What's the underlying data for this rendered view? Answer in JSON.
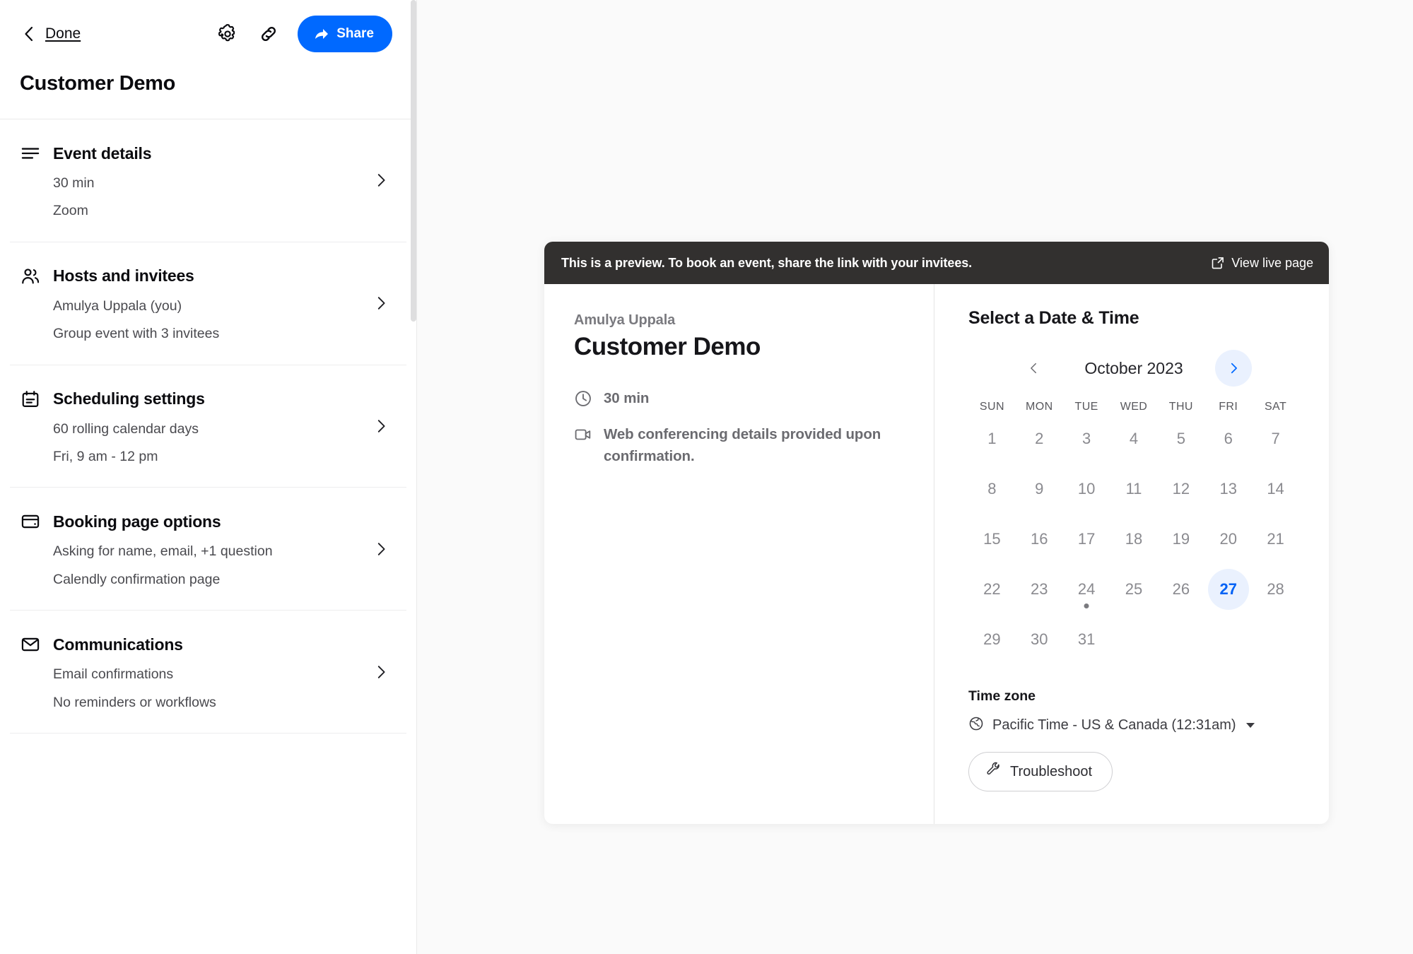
{
  "sidebar": {
    "back_label": "back-chevron",
    "done_label": "Done",
    "gear_icon": "gear-icon",
    "link_icon": "link-icon",
    "share_label": "Share",
    "event_title": "Customer Demo",
    "sections": [
      {
        "icon": "lines-icon",
        "title": "Event details",
        "lines": [
          "30 min",
          "Zoom"
        ]
      },
      {
        "icon": "people-icon",
        "title": "Hosts and invitees",
        "lines": [
          "Amulya Uppala (you)",
          "Group event with 3 invitees"
        ]
      },
      {
        "icon": "calendar-icon",
        "title": "Scheduling settings",
        "lines": [
          "60 rolling calendar days",
          "Fri, 9 am - 12 pm"
        ]
      },
      {
        "icon": "card-icon",
        "title": "Booking page options",
        "lines": [
          "Asking for name, email, +1 question",
          "Calendly confirmation page"
        ]
      },
      {
        "icon": "envelope-icon",
        "title": "Communications",
        "lines": [
          "Email confirmations",
          "No reminders or workflows"
        ]
      }
    ]
  },
  "preview": {
    "banner_text": "This is a preview. To book an event, share the link with your invitees.",
    "view_live_label": "View live page",
    "event": {
      "host": "Amulya Uppala",
      "name": "Customer Demo",
      "duration": "30 min",
      "location": "Web conferencing details provided upon confirmation."
    },
    "calendar": {
      "title": "Select a Date & Time",
      "month": "October 2023",
      "weekdays": [
        "SUN",
        "MON",
        "TUE",
        "WED",
        "THU",
        "FRI",
        "SAT"
      ],
      "leading_blanks": 0,
      "days": [
        1,
        2,
        3,
        4,
        5,
        6,
        7,
        8,
        9,
        10,
        11,
        12,
        13,
        14,
        15,
        16,
        17,
        18,
        19,
        20,
        21,
        22,
        23,
        24,
        25,
        26,
        27,
        28,
        29,
        30,
        31
      ],
      "selected_day": 27,
      "dotted_days": [
        24
      ],
      "prev_label": "prev-month",
      "next_label": "next-month"
    },
    "timezone": {
      "title": "Time zone",
      "value": "Pacific Time - US & Canada (12:31am)",
      "troubleshoot_label": "Troubleshoot"
    }
  },
  "colors": {
    "brand_blue": "#0069ff",
    "selected_blue": "#0062f5",
    "selected_bg": "#eaf1fe",
    "banner_dark": "#32302f",
    "page_bg": "#fafafa"
  }
}
